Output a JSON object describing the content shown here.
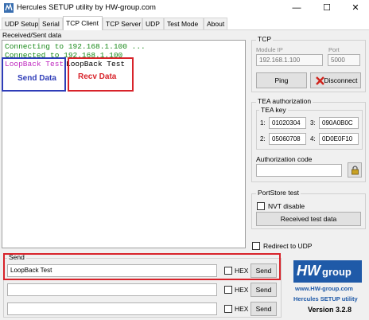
{
  "window": {
    "title": "Hercules SETUP utility by HW-group.com",
    "minimize": "—",
    "maximize": "☐",
    "close": "✕"
  },
  "tabs": [
    "UDP Setup",
    "Serial",
    "TCP Client",
    "TCP Server",
    "UDP",
    "Test Mode",
    "About"
  ],
  "log": {
    "label": "Received/Sent data",
    "lines": [
      "Connecting to 192.168.1.100 ...",
      "Connected to 192.168.1.100"
    ],
    "sent_text": "LoopBack Test",
    "recv_text": "LoopBack Test"
  },
  "annotations": {
    "send_data": "Send Data",
    "recv_data": "Recv Data"
  },
  "tcp": {
    "title": "TCP",
    "module_ip_label": "Module IP",
    "module_ip": "192.168.1.100",
    "port_label": "Port",
    "port": "5000",
    "ping_label": "Ping",
    "disconnect_label": "Disconnect"
  },
  "tea": {
    "title": "TEA authorization",
    "key_label": "TEA key",
    "k1_label": "1:",
    "k1": "01020304",
    "k2_label": "2:",
    "k2": "05060708",
    "k3_label": "3:",
    "k3": "090A0B0C",
    "k4_label": "4:",
    "k4": "0D0E0F10",
    "auth_code_label": "Authorization code",
    "auth_code": ""
  },
  "portstore": {
    "title": "PortStore test",
    "nvt_disable": "NVT disable",
    "received_test_data": "Received test data"
  },
  "redirect_udp": "Redirect to UDP",
  "send": {
    "title": "Send",
    "rows": [
      {
        "value": "LoopBack Test",
        "hex": "HEX",
        "button": "Send"
      },
      {
        "value": "",
        "hex": "HEX",
        "button": "Send"
      },
      {
        "value": "",
        "hex": "HEX",
        "button": "Send"
      }
    ]
  },
  "logo": {
    "brand_hw": "HW",
    "brand_group": "group",
    "url": "www.HW-group.com",
    "product": "Hercules SETUP utility",
    "version": "Version  3.2.8"
  },
  "colors": {
    "log_green": "#1a8a1a",
    "send_pink": "#c02cc0",
    "annot_blue": "#2f3db8",
    "annot_red": "#d8232a",
    "logo_blue": "#1f5aa8"
  }
}
